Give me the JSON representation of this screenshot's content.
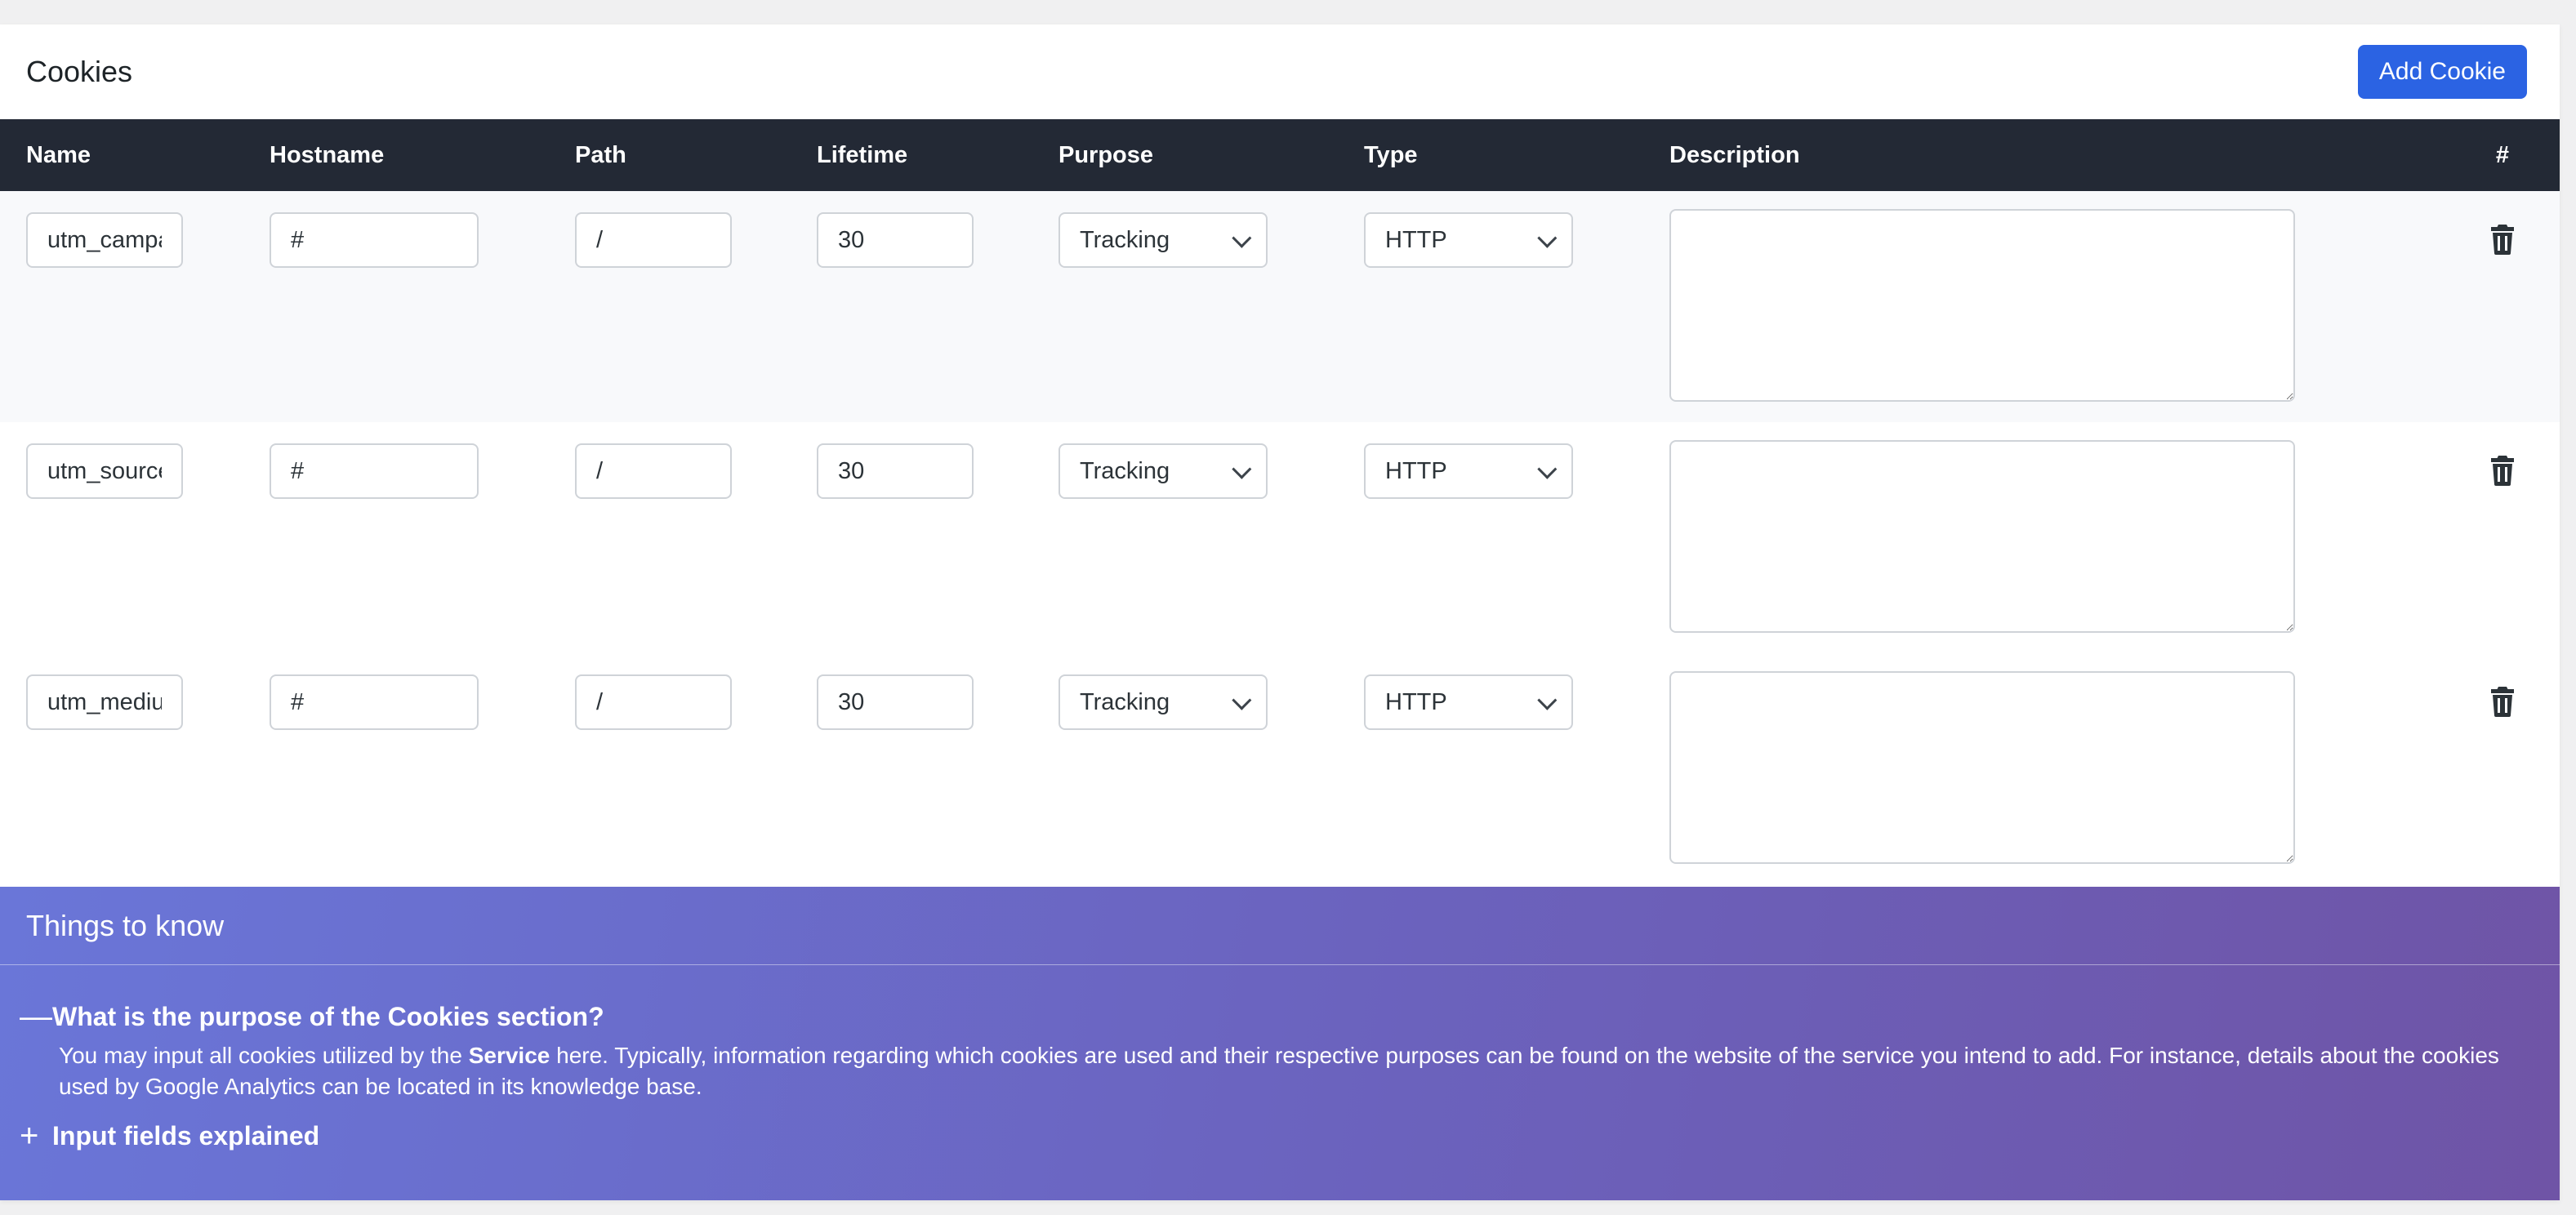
{
  "header": {
    "title": "Cookies",
    "add_button": "Add Cookie"
  },
  "table": {
    "columns": [
      "Name",
      "Hostname",
      "Path",
      "Lifetime",
      "Purpose",
      "Type",
      "Description",
      "#"
    ],
    "rows": [
      {
        "name": "utm_campaign",
        "hostname": "#",
        "path": "/",
        "lifetime": "30",
        "purpose": "Tracking",
        "type": "HTTP",
        "description": ""
      },
      {
        "name": "utm_source",
        "hostname": "#",
        "path": "/",
        "lifetime": "30",
        "purpose": "Tracking",
        "type": "HTTP",
        "description": ""
      },
      {
        "name": "utm_medium",
        "hostname": "#",
        "path": "/",
        "lifetime": "30",
        "purpose": "Tracking",
        "type": "HTTP",
        "description": ""
      }
    ]
  },
  "info": {
    "title": "Things to know",
    "faq": [
      {
        "question": "What is the purpose of the Cookies section?",
        "toggle": "—",
        "answer_before": "You may input all cookies utilized by the ",
        "answer_bold": "Service",
        "answer_after": " here. Typically, information regarding which cookies are used and their respective purposes can be found on the website of the service you intend to add. For instance, details about the cookies used by Google Analytics can be located in its knowledge base."
      },
      {
        "question": "Input fields explained",
        "toggle": "+"
      }
    ]
  },
  "icons": {
    "delete": "trash-icon",
    "dropdown": "chevron-down-icon"
  }
}
